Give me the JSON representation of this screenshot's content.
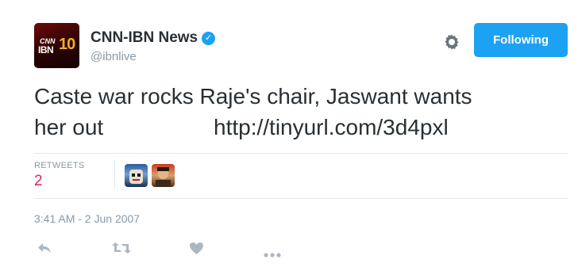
{
  "account": {
    "display_name": "CNN-IBN News",
    "handle": "@ibnlive",
    "verified_glyph": "✓",
    "avatar_logo": {
      "cnn": "CNN",
      "ibn": "IBN",
      "ten": "10"
    }
  },
  "header": {
    "follow_button_label": "Following",
    "settings_icon": "gear-icon"
  },
  "tweet": {
    "text_line1": "Caste war rocks Raje's chair, Jaswant wants",
    "text_line2": "her out",
    "link": "http://tinyurl.com/3d4pxl"
  },
  "stats": {
    "retweets_label": "RETWEETS",
    "retweets_count": "2"
  },
  "timestamp": "3:41 AM - 2 Jun 2007",
  "actions": [
    "reply-icon",
    "retweet-icon",
    "like-icon",
    "more-icon"
  ],
  "colors": {
    "accent": "#1da1f2",
    "retweet_count": "#e0245e",
    "muted": "#8899a6"
  }
}
